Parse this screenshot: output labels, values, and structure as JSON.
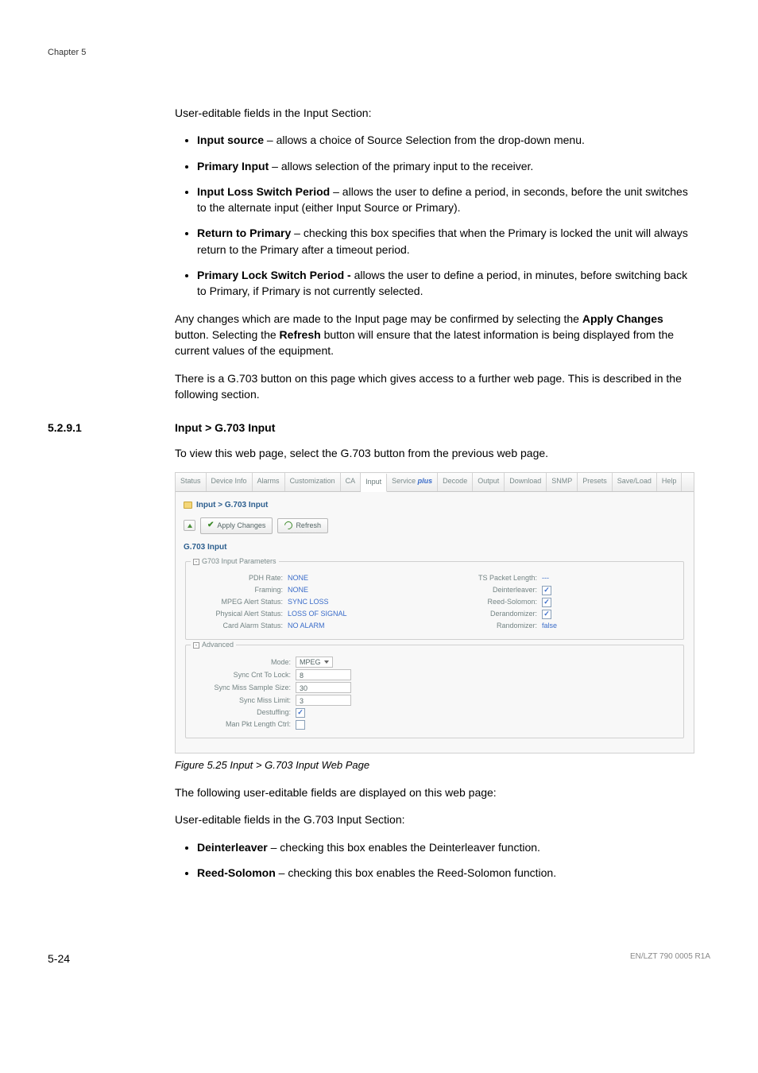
{
  "chapter_label": "Chapter 5",
  "intro": "User-editable fields in the Input Section:",
  "bullets_main": [
    {
      "bold": "Input source",
      "rest": " – allows a choice of Source Selection from the drop-down menu."
    },
    {
      "bold": "Primary Input",
      "rest": " – allows selection of the primary input to the receiver."
    },
    {
      "bold": "Input Loss Switch Period",
      "rest": " – allows the user to define a period, in seconds, before the unit switches to the alternate input (either Input Source or Primary)."
    },
    {
      "bold": "Return to Primary",
      "rest": " – checking this box specifies that when the Primary is locked the unit will always return to the Primary after a timeout period."
    },
    {
      "bold": "Primary Lock Switch Period -",
      "rest": " allows the user to define a period, in minutes, before switching back to Primary, if Primary is not currently selected."
    }
  ],
  "para1_a": "Any changes which are made to the Input page may be confirmed by selecting the ",
  "para1_b": "Apply Changes",
  "para1_c": " button. Selecting the ",
  "para1_d": "Refresh",
  "para1_e": " button will ensure that the latest information is being displayed from the current values of the equipment.",
  "para2": "There is a G.703 button on this page which gives access to a further web page. This is described in the following section.",
  "section_number": "5.2.9.1",
  "section_title": "Input > G.703 Input",
  "section_intro": "To view this web page, select the G.703 button from the previous web page.",
  "figure_caption": "Figure 5.25 Input > G.703 Input Web Page",
  "after1": "The following user-editable fields are displayed on this web page:",
  "after2": "User-editable fields in the G.703 Input Section:",
  "bullets_after": [
    {
      "bold": "Deinterleaver",
      "rest": " – checking this box enables the Deinterleaver function."
    },
    {
      "bold": "Reed-Solomon",
      "rest": " – checking this box enables the Reed-Solomon function."
    }
  ],
  "footer_left": "5-24",
  "footer_right": "EN/LZT 790 0005 R1A",
  "shot": {
    "tabs": [
      "Status",
      "Device Info",
      "Alarms",
      "Customization",
      "CA",
      "Input",
      "Service plus",
      "Decode",
      "Output",
      "Download",
      "SNMP",
      "Presets",
      "Save/Load",
      "Help"
    ],
    "active_tab_index": 5,
    "breadcrumb": "Input > G.703 Input",
    "btn_apply": "Apply Changes",
    "btn_refresh": "Refresh",
    "panel_title": "G.703 Input",
    "legend1": "G703 Input Parameters",
    "params_left": [
      {
        "k": "PDH Rate:",
        "v": "NONE"
      },
      {
        "k": "Framing:",
        "v": "NONE"
      },
      {
        "k": "MPEG Alert Status:",
        "v": "SYNC LOSS"
      },
      {
        "k": "Physical Alert Status:",
        "v": "LOSS OF SIGNAL"
      },
      {
        "k": "Card Alarm Status:",
        "v": "NO ALARM"
      }
    ],
    "params_right": [
      {
        "k": "TS Packet Length:",
        "type": "text",
        "v": "---"
      },
      {
        "k": "Deinterleaver:",
        "type": "check",
        "v": true
      },
      {
        "k": "Reed-Solomon:",
        "type": "check",
        "v": true
      },
      {
        "k": "Derandomizer:",
        "type": "check",
        "v": true
      },
      {
        "k": "Randomizer:",
        "type": "textv",
        "v": "false"
      }
    ],
    "legend2": "Advanced",
    "advanced": [
      {
        "k": "Mode:",
        "type": "select",
        "v": "MPEG"
      },
      {
        "k": "Sync Cnt To Lock:",
        "type": "input",
        "v": "8"
      },
      {
        "k": "Sync Miss Sample Size:",
        "type": "input",
        "v": "30"
      },
      {
        "k": "Sync Miss Limit:",
        "type": "input",
        "v": "3"
      },
      {
        "k": "Destuffing:",
        "type": "check",
        "v": true
      },
      {
        "k": "Man Pkt Length Ctrl:",
        "type": "check",
        "v": false
      }
    ]
  }
}
